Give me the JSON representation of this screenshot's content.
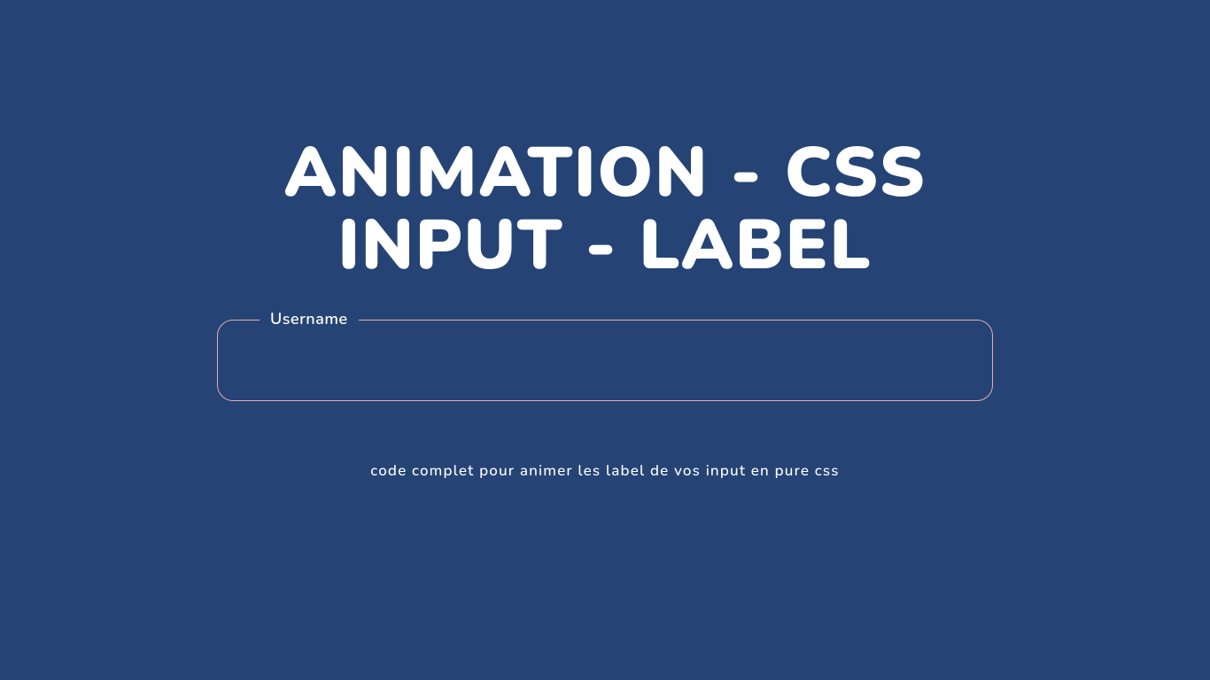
{
  "title": {
    "line1": "ANIMATION - CSS",
    "line2": "INPUT - LABEL"
  },
  "form": {
    "username_label": "Username",
    "username_value": ""
  },
  "subtitle": "code complet pour animer les label de vos input en pure css",
  "colors": {
    "background": "#254475",
    "border": "#e4aab3",
    "text": "#ffffff"
  }
}
